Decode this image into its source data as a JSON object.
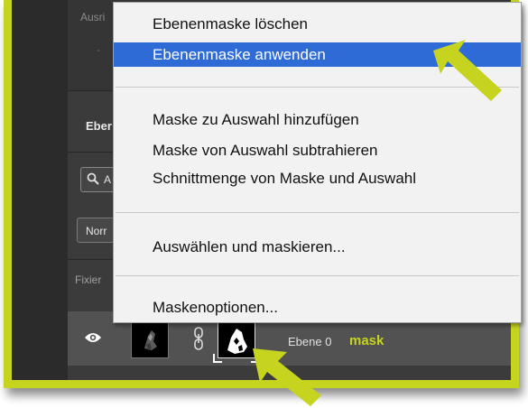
{
  "panel": {
    "properties_label": "Ausri",
    "properties_dash": "-",
    "layers_tab": "Eber",
    "search_text": "A",
    "blend_mode": "Norr",
    "lock_label": "Fixier"
  },
  "layer": {
    "name": "Ebene 0",
    "annotation": "mask"
  },
  "menu": {
    "items": [
      {
        "label": "Ebenenmaske löschen"
      },
      {
        "label": "Ebenenmaske anwenden"
      },
      {
        "label": "Maske zu Auswahl hinzufügen"
      },
      {
        "label": "Maske von Auswahl subtrahieren"
      },
      {
        "label": "Schnittmenge von Maske und Auswahl"
      },
      {
        "label": "Auswählen und maskieren..."
      },
      {
        "label": "Maskenoptionen..."
      }
    ],
    "active_item": "Ebenenmaske anwenden"
  },
  "colors": {
    "accent_yellow": "#c6d420",
    "menu_highlight": "#2f6bd6",
    "panel_bg": "#3b3b3b"
  },
  "icons": [
    "search-icon",
    "eye-icon",
    "link-chain-icon",
    "arrow-pointer-icon"
  ]
}
